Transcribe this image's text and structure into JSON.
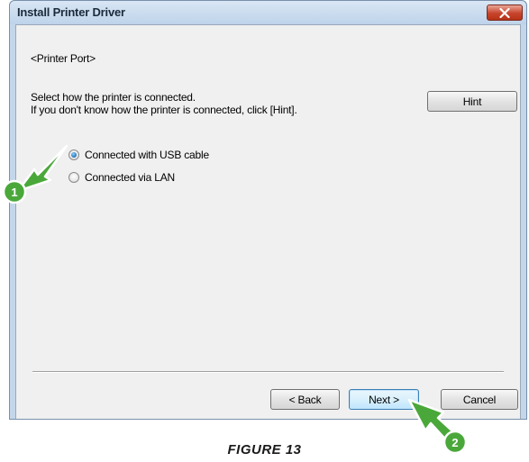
{
  "window": {
    "title": "Install Printer Driver",
    "close_icon": "close-icon"
  },
  "content": {
    "section_label": "<Printer Port>",
    "instruction_line1": "Select how the printer is connected.",
    "instruction_line2": "If you don't know how the printer is connected, click [Hint].",
    "hint_button": "Hint",
    "options": [
      {
        "label": "Connected with USB cable",
        "selected": true
      },
      {
        "label": "Connected via LAN",
        "selected": false
      }
    ]
  },
  "footer": {
    "back_button": "< Back",
    "next_button": "Next >",
    "cancel_button": "Cancel"
  },
  "callouts": [
    {
      "number": "1",
      "color": "#3a9a2a"
    },
    {
      "number": "2",
      "color": "#3a9a2a"
    }
  ],
  "caption": "FIGURE 13"
}
